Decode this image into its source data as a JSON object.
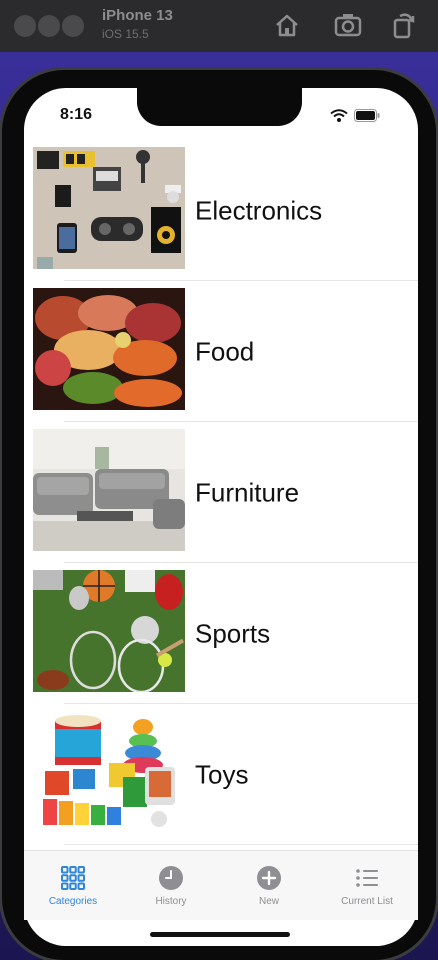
{
  "simulator": {
    "device": "iPhone 13",
    "os": "iOS 15.5"
  },
  "status_bar": {
    "time": "8:16"
  },
  "categories": [
    {
      "label": "Electronics",
      "image": "electronics-photo"
    },
    {
      "label": "Food",
      "image": "food-photo"
    },
    {
      "label": "Furniture",
      "image": "furniture-photo"
    },
    {
      "label": "Sports",
      "image": "sports-photo"
    },
    {
      "label": "Toys",
      "image": "toys-photo"
    }
  ],
  "tabbar": {
    "tabs": [
      {
        "label": "Categories",
        "icon": "grid-icon",
        "active": true
      },
      {
        "label": "History",
        "icon": "clock-icon",
        "active": false
      },
      {
        "label": "New",
        "icon": "plus-circle-icon",
        "active": false
      },
      {
        "label": "Current List",
        "icon": "list-icon",
        "active": false
      }
    ]
  },
  "colors": {
    "accent": "#2f86d8",
    "inactive": "#8e8e93"
  }
}
